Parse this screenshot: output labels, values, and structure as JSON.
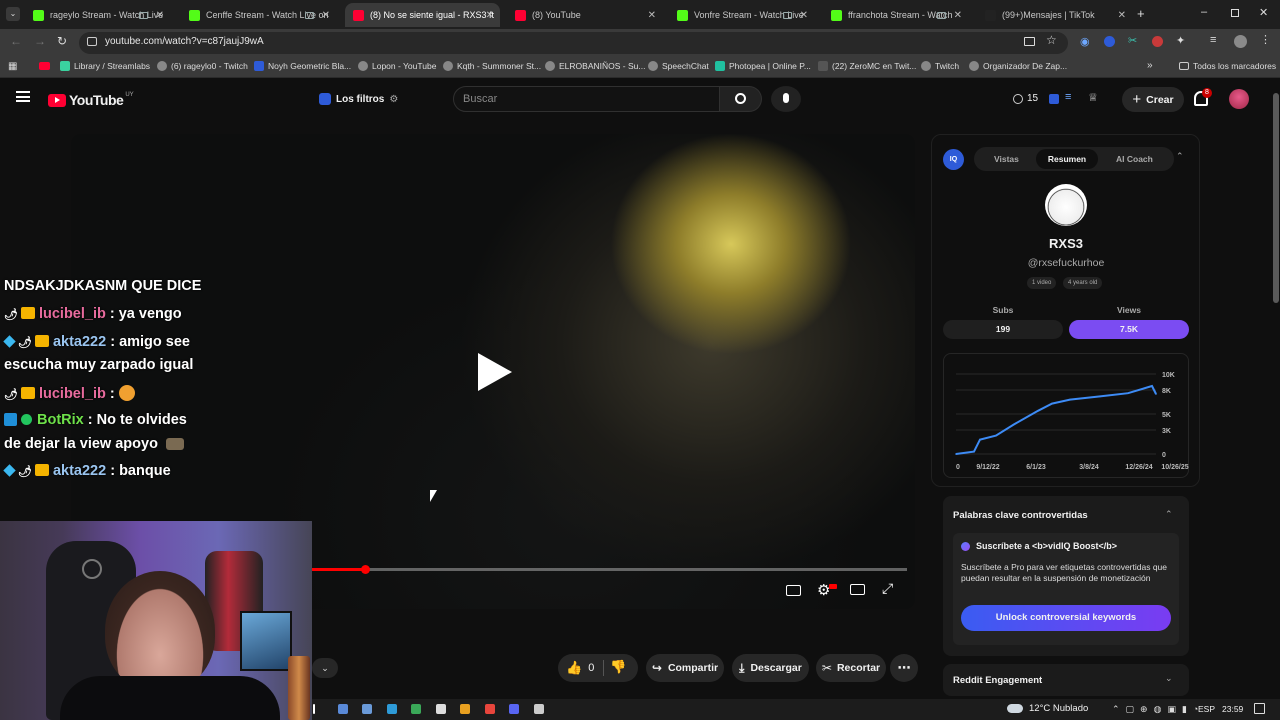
{
  "tabs": [
    {
      "title": "rageylo Stream - Watch Live",
      "color": "#53fc18"
    },
    {
      "title": "Cenffe Stream - Watch Live on",
      "color": "#53fc18"
    },
    {
      "title": "(8) No se siente igual - RXS3 ft",
      "color": "#ff0033"
    },
    {
      "title": "(8) YouTube",
      "color": "#ff0033"
    },
    {
      "title": "Vonfre Stream - Watch Live",
      "color": "#53fc18"
    },
    {
      "title": "ffranchota Stream - Watch",
      "color": "#53fc18"
    },
    {
      "title": "(99+)Mensajes | TikTok",
      "color": "#222222"
    }
  ],
  "url": "youtube.com/watch?v=c87jaujJ9wA",
  "bookmarks": [
    "Library / Streamlabs",
    "(6) rageylo0 - Twitch",
    "Noyh Geometric Bla...",
    "Lopon - YouTube",
    "Kqth - Summoner St...",
    "ELROBANIÑOS - Su...",
    "SpeechChat",
    "Photopea | Online P...",
    "(22) ZeroMC en Twit...",
    "Twitch",
    "Organizador De Zap..."
  ],
  "bookmarks_all": "Todos los marcadores",
  "yt": {
    "logo": "YouTube",
    "country": "UY",
    "filters": "Los filtros",
    "search_placeholder": "Buscar",
    "history_count": "15",
    "create": "Crear",
    "notif_count": "8"
  },
  "chat": [
    {
      "user": "",
      "text": "NDSAKJDKASNM QUE DICE",
      "color": "#ffffff"
    },
    {
      "user": "lucibel_ib",
      "text": ": ya vengo",
      "color": "#e86b9e"
    },
    {
      "user": "akta222",
      "text": ": amigo see",
      "color": "#9ac5f0"
    },
    {
      "user": "",
      "text": "escucha muy zarpado igual",
      "color": "#ffffff"
    },
    {
      "user": "lucibel_ib",
      "text": ":",
      "color": "#e86b9e"
    },
    {
      "user": "BotRix",
      "text": ": No te olvides",
      "color": "#6ee04a"
    },
    {
      "user": "",
      "text": "de dejar la view apoyo",
      "color": "#ffffff"
    },
    {
      "user": "akta222",
      "text": ": banque",
      "color": "#9ac5f0"
    }
  ],
  "actions": {
    "likes": "0",
    "share": "Compartir",
    "download": "Descargar",
    "clip": "Recortar"
  },
  "progress": 0.09,
  "vidiq": {
    "tabs": [
      "Vistas",
      "Resumen",
      "AI Coach"
    ],
    "channel": "RXS3",
    "handle": "@rxsefuckurhoe",
    "videos": "1 video",
    "age": "4 years old",
    "subs_label": "Subs",
    "views_label": "Views",
    "subs": "199",
    "views": "7.5K",
    "kw_title": "Palabras clave controvertidas",
    "kw_promo": "Suscríbete a <b>vidIQ Boost</b>",
    "kw_desc": "Suscríbete a Pro para ver etiquetas controvertidas que puedan resultar en la suspensión de monetización",
    "kw_button": "Unlock controversial keywords",
    "reddit": "Reddit Engagement"
  },
  "chart_data": {
    "type": "line",
    "x": [
      "2021-10",
      "2022-01",
      "2022-09-12",
      "2022-12",
      "2023-06-01",
      "2023-12",
      "2024-03-08",
      "2024-08",
      "2024-12-26",
      "2025-06",
      "2025-10-01",
      "2025-10-26"
    ],
    "values": [
      0,
      300,
      1800,
      2300,
      3700,
      5400,
      6300,
      6800,
      7200,
      7600,
      8500,
      7500
    ],
    "ylim": [
      0,
      10000
    ],
    "yticks": [
      "10K",
      "8K",
      "5K",
      "3K",
      "0"
    ],
    "xticks": [
      "0",
      "9/12/22",
      "6/1/23",
      "3/8/24",
      "12/26/24",
      "10/26/25"
    ]
  },
  "taskbar": {
    "weather": "12°C",
    "condition": "Nublado",
    "lang": "ESP",
    "time": "23:59"
  }
}
